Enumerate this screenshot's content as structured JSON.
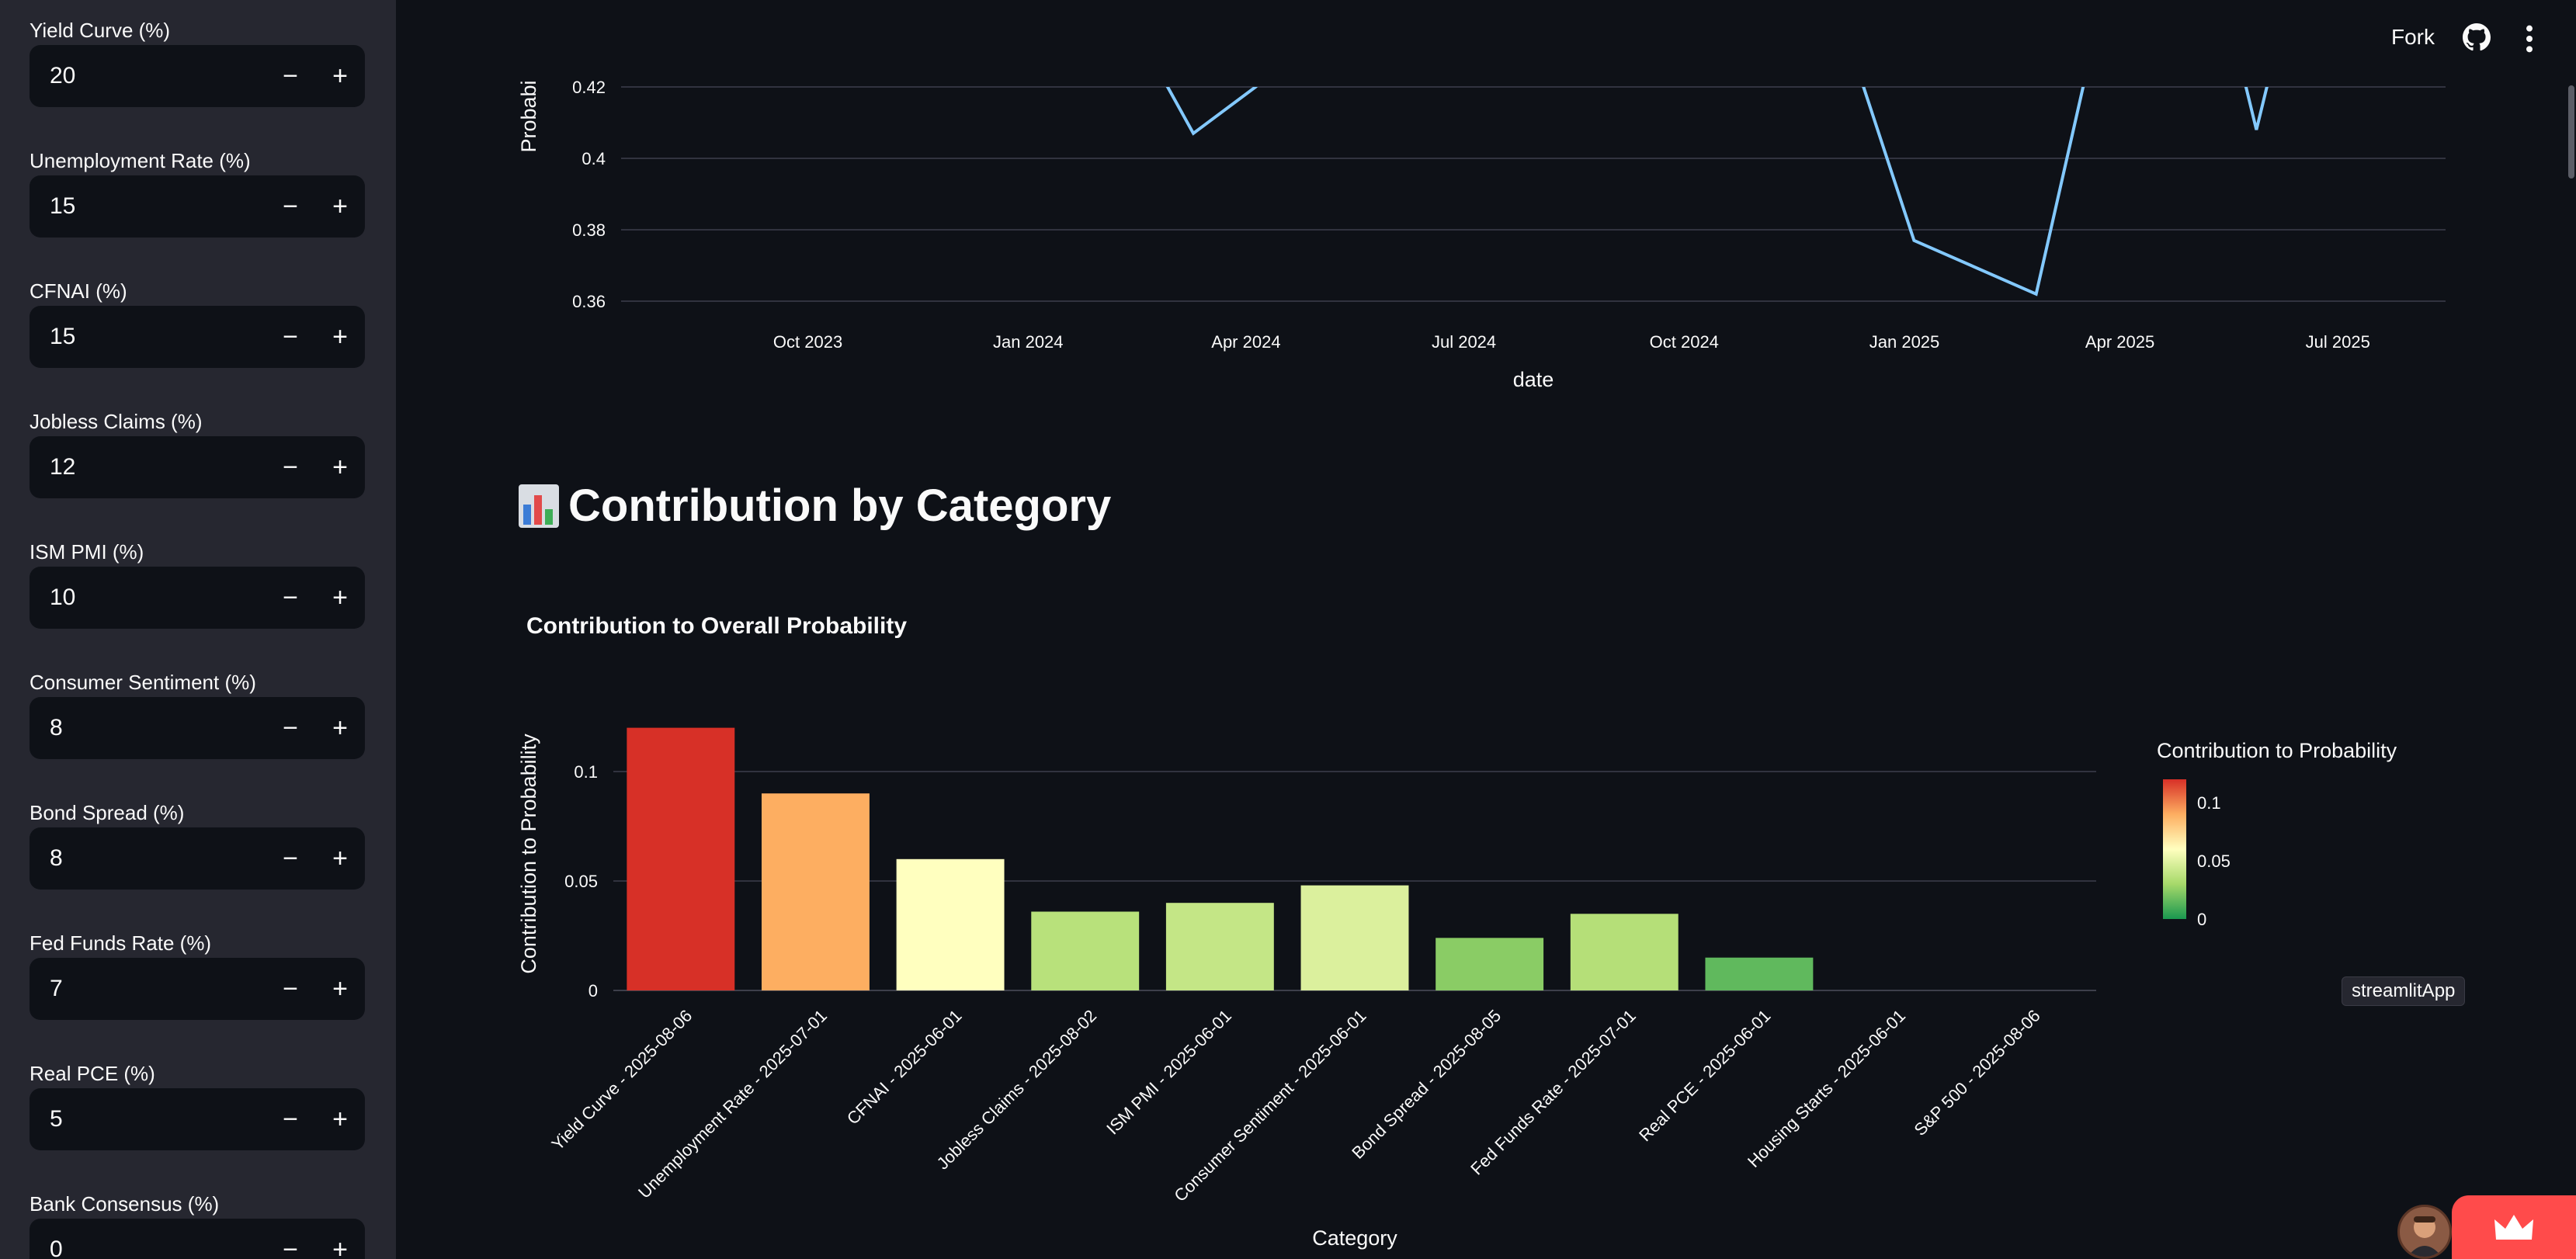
{
  "sidebar": {
    "fields": [
      {
        "label": "Yield Curve (%)",
        "value": "20"
      },
      {
        "label": "Unemployment Rate (%)",
        "value": "15"
      },
      {
        "label": "CFNAI (%)",
        "value": "15"
      },
      {
        "label": "Jobless Claims (%)",
        "value": "12"
      },
      {
        "label": "ISM PMI (%)",
        "value": "10"
      },
      {
        "label": "Consumer Sentiment (%)",
        "value": "8"
      },
      {
        "label": "Bond Spread (%)",
        "value": "8"
      },
      {
        "label": "Fed Funds Rate (%)",
        "value": "7"
      },
      {
        "label": "Real PCE (%)",
        "value": "5"
      },
      {
        "label": "Bank Consensus (%)",
        "value": "0"
      }
    ],
    "minus_symbol": "−",
    "plus_symbol": "+"
  },
  "topbar": {
    "fork_label": "Fork",
    "github_icon": "github-icon",
    "menu_icon": "kebab-menu-icon"
  },
  "section_heading": {
    "icon": "bar-chart-icon",
    "text": "Contribution by Category"
  },
  "floating": {
    "tag_label": "streamlitApp",
    "avatar_icon": "user-avatar-icon",
    "crown_icon": "crown-icon"
  },
  "chart_data": [
    {
      "type": "line",
      "xlabel": "date",
      "ylabel": "Probabi",
      "x_tick_labels": [
        "Oct 2023",
        "Jan 2024",
        "Apr 2024",
        "Jul 2024",
        "Oct 2024",
        "Jan 2025",
        "Apr 2025",
        "Jul 2025"
      ],
      "y_tick_labels": [
        "0.36",
        "0.38",
        "0.4",
        "0.42"
      ],
      "ylim_visible": [
        0.355,
        0.425
      ],
      "series": [
        {
          "color": "#83c9ff",
          "points": [
            {
              "x": "2024-02-20",
              "y": 0.43
            },
            {
              "x": "2024-03-10",
              "y": 0.407
            },
            {
              "x": "2024-04-05",
              "y": 0.42
            },
            {
              "x": "2024-04-20",
              "y": 0.43
            },
            {
              "x": "2024-12-10",
              "y": 0.43
            },
            {
              "x": "2025-01-05",
              "y": 0.377
            },
            {
              "x": "2025-02-25",
              "y": 0.362
            },
            {
              "x": "2025-03-20",
              "y": 0.43
            },
            {
              "x": "2025-05-20",
              "y": 0.43
            },
            {
              "x": "2025-05-28",
              "y": 0.408
            },
            {
              "x": "2025-06-05",
              "y": 0.43
            }
          ]
        }
      ]
    },
    {
      "type": "bar",
      "title": "Contribution to Overall Probability",
      "xlabel": "Category",
      "ylabel": "Contribution to Probability",
      "categories": [
        "Yield Curve - 2025-08-06",
        "Unemployment Rate - 2025-07-01",
        "CFNAI - 2025-06-01",
        "Jobless Claims - 2025-08-02",
        "ISM PMI - 2025-06-01",
        "Consumer Sentiment - 2025-06-01",
        "Bond Spread - 2025-08-05",
        "Fed Funds Rate - 2025-07-01",
        "Real PCE - 2025-06-01",
        "Housing Starts - 2025-06-01",
        "S&P 500 - 2025-08-06"
      ],
      "values": [
        0.12,
        0.09,
        0.06,
        0.036,
        0.04,
        0.048,
        0.024,
        0.035,
        0.015,
        0,
        0
      ],
      "ylim": [
        0,
        0.12
      ],
      "y_tick_values": [
        0,
        0.05,
        0.1
      ],
      "y_tick_labels": [
        "0",
        "0.05",
        "0.1"
      ],
      "colorbar": {
        "title": "Contribution to Probability",
        "tick_labels": [
          "0.1",
          "0.05",
          "0"
        ],
        "colors": [
          "#1a9850",
          "#a6d96a",
          "#ffffbf",
          "#fdae61",
          "#d73027"
        ]
      },
      "grid": true
    }
  ]
}
